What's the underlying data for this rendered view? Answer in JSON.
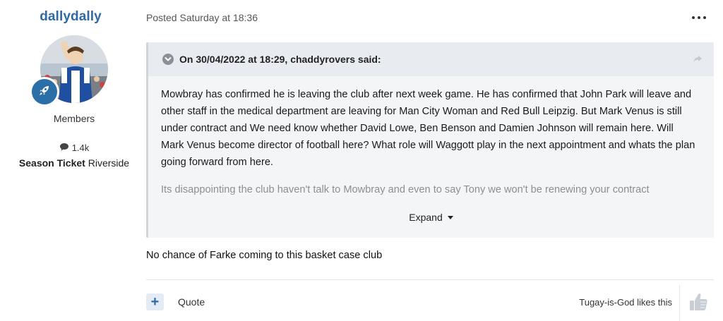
{
  "author": {
    "name": "dallydally",
    "group": "Members",
    "post_count": "1.4k",
    "season_label": "Season Ticket",
    "season_value": "Riverside"
  },
  "post": {
    "posted": "Posted Saturday at 18:36",
    "quote": {
      "citation": "On 30/04/2022 at 18:29, chaddyrovers said:",
      "paragraph1": "Mowbray has confirmed he is leaving the club after next week game. He has confirmed that John Park will leave and other staff in the medical department are leaving for Man City Woman and Red Bull Leipzig. But Mark Venus is still under contract and We need know whether David Lowe, Ben Benson and Damien Johnson will remain here. Will Mark Venus become director of football here? What role will Waggott play in the next appointment and whats the plan going forward from here.",
      "paragraph2": "Its disappointing the club haven't talk to Mowbray and even to say Tony we won't be renewing your contract",
      "expand_label": "Expand"
    },
    "reply": "No chance of Farke coming to this basket case club"
  },
  "actions": {
    "plus": "+",
    "quote_label": "Quote",
    "likes_text": "Tugay-is-God likes this"
  },
  "colors": {
    "accent": "#2f6aa5",
    "badge": "#2c6ea8",
    "quote_bg": "#f3f5f7",
    "quote_head_bg": "#e8ecf0"
  },
  "icons": [
    "rocket-icon",
    "speech-bubble-icon",
    "more-dots-icon",
    "chevron-down-icon",
    "share-arrow-icon",
    "caret-down-icon",
    "thumbs-up-icon"
  ]
}
